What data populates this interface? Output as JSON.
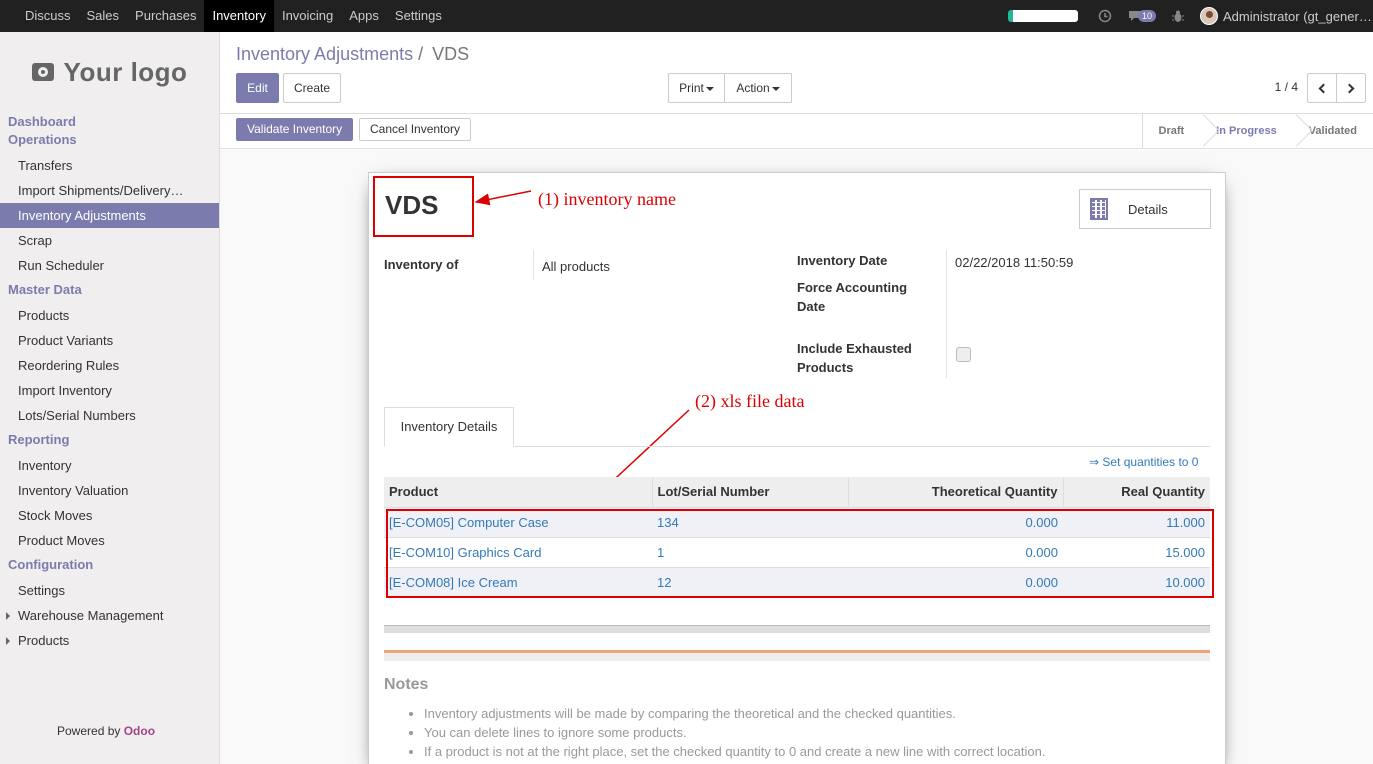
{
  "topbar": {
    "menu": [
      "Discuss",
      "Sales",
      "Purchases",
      "Inventory",
      "Invoicing",
      "Apps",
      "Settings"
    ],
    "active": "Inventory",
    "chat_count": "10",
    "user": "Administrator (gt_gener…"
  },
  "sidebar": {
    "logo_text": "Your logo",
    "sections": {
      "dashboard": "Dashboard",
      "operations": "Operations",
      "master_data": "Master Data",
      "reporting": "Reporting",
      "configuration": "Configuration"
    },
    "operations_items": [
      "Transfers",
      "Import Shipments/Delivery…",
      "Inventory Adjustments",
      "Scrap",
      "Run Scheduler"
    ],
    "master_items": [
      "Products",
      "Product Variants",
      "Reordering Rules",
      "Import Inventory",
      "Lots/Serial Numbers"
    ],
    "reporting_items": [
      "Inventory",
      "Inventory Valuation",
      "Stock Moves",
      "Product Moves"
    ],
    "config_items": [
      "Settings",
      "Warehouse Management",
      "Products"
    ],
    "powered_by": "Powered by",
    "odoo": "Odoo"
  },
  "control_panel": {
    "breadcrumb_parent": "Inventory Adjustments",
    "breadcrumb_sep": "/",
    "breadcrumb_current": "VDS",
    "edit": "Edit",
    "create": "Create",
    "print": "Print",
    "action": "Action",
    "pager": "1 / 4"
  },
  "statusbar": {
    "validate": "Validate Inventory",
    "cancel": "Cancel Inventory",
    "stages": [
      "Draft",
      "In Progress",
      "Validated"
    ],
    "current_stage": "In Progress"
  },
  "form": {
    "name": "VDS",
    "details_button": "Details",
    "inventory_of_label": "Inventory of",
    "inventory_of_value": "All products",
    "inventory_date_label": "Inventory Date",
    "inventory_date_value": "02/22/2018 11:50:59",
    "force_accounting_label_1": "Force Accounting",
    "force_accounting_label_2": "Date",
    "include_exhausted_label_1": "Include Exhausted",
    "include_exhausted_label_2": "Products",
    "include_exhausted_checked": false,
    "tab": "Inventory Details",
    "set_quantities": "⇒ Set quantities to 0",
    "columns": [
      "Product",
      "Lot/Serial Number",
      "Theoretical Quantity",
      "Real Quantity"
    ],
    "rows": [
      {
        "product": "[E-COM05] Computer Case",
        "lot": "134",
        "theoretical": "0.000",
        "real": "11.000"
      },
      {
        "product": "[E-COM10] Graphics Card",
        "lot": "1",
        "theoretical": "0.000",
        "real": "15.000"
      },
      {
        "product": "[E-COM08] Ice Cream",
        "lot": "12",
        "theoretical": "0.000",
        "real": "10.000"
      }
    ],
    "notes_title": "Notes",
    "notes": [
      "Inventory adjustments will be made by comparing the theoretical and the checked quantities.",
      "You can delete lines to ignore some products.",
      "If a product is not at the right place, set the checked quantity to 0 and create a new line with correct location."
    ]
  },
  "annotations": {
    "one": "(1) inventory name",
    "two": "(2) xls file data"
  },
  "colors": {
    "accent": "#7c7bad",
    "annotation": "#dd0000",
    "link": "#337ab7"
  }
}
